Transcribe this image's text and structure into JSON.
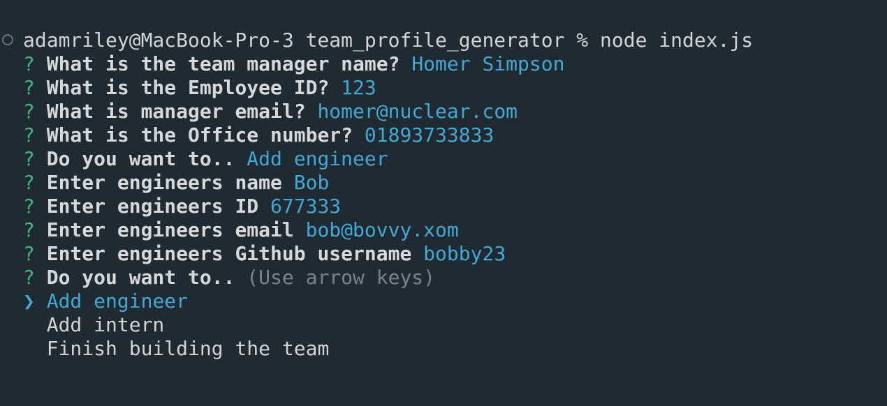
{
  "command_line": {
    "prompt": "adamriley@MacBook-Pro-3 team_profile_generator % ",
    "command": "node index.js"
  },
  "prompt_symbol": "?",
  "answered": [
    {
      "question": "What is the team manager name?",
      "answer": "Homer Simpson"
    },
    {
      "question": "What is the Employee ID?",
      "answer": "123"
    },
    {
      "question": "What is manager email?",
      "answer": "homer@nuclear.com"
    },
    {
      "question": "What is the Office number?",
      "answer": "01893733833"
    },
    {
      "question": "Do you want to..",
      "answer": "Add engineer"
    },
    {
      "question": "Enter engineers name",
      "answer": "Bob"
    },
    {
      "question": "Enter engineers ID",
      "answer": "677333"
    },
    {
      "question": "Enter engineers email",
      "answer": "bob@bovvy.xom"
    },
    {
      "question": "Enter engineers Github username",
      "answer": "bobby23"
    }
  ],
  "active": {
    "question": "Do you want to..",
    "hint": "(Use arrow keys)"
  },
  "pointer": "❯",
  "options": [
    "Add engineer",
    "Add intern",
    "Finish building the team"
  ],
  "colors": {
    "background": "#1f2a33",
    "question_mark": "#3fb77c",
    "answer": "#45a8d2",
    "hint": "#7b8389"
  }
}
